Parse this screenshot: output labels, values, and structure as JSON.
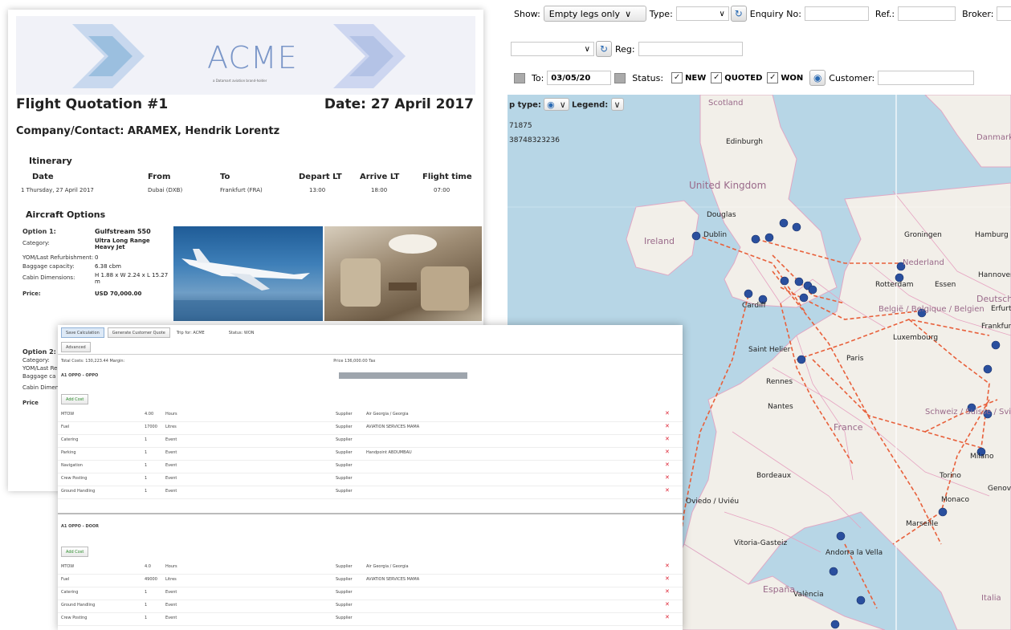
{
  "map_toolbar": {
    "show_label": "Show:",
    "show_value": "Empty legs only",
    "type_label": "Type:",
    "enquiry_label": "Enquiry No:",
    "ref_label": "Ref.:",
    "broker_label": "Broker:",
    "reg_label": "Reg:",
    "to_label": "To:",
    "to_value": "03/05/20",
    "status_label": "Status:",
    "statuses": [
      "NEW",
      "QUOTED",
      "WON"
    ],
    "customer_label": "Customer:",
    "map_type_label": "p type:",
    "legend_label": "Legend:",
    "coord_1": "71875",
    "coord_2": "38748323236"
  },
  "map": {
    "labels": [
      {
        "text": "Edinburgh",
        "kind": "city"
      },
      {
        "text": "United Kingdom",
        "kind": "country"
      },
      {
        "text": "Douglas",
        "kind": "city"
      },
      {
        "text": "Ireland",
        "kind": "country"
      },
      {
        "text": "Dublin",
        "kind": "city"
      },
      {
        "text": "Cardiff",
        "kind": "city"
      },
      {
        "text": "Groningen",
        "kind": "city"
      },
      {
        "text": "Hamburg",
        "kind": "city"
      },
      {
        "text": "Nederland",
        "kind": "country"
      },
      {
        "text": "Rotterdam",
        "kind": "city"
      },
      {
        "text": "Essen",
        "kind": "city"
      },
      {
        "text": "Hannover",
        "kind": "city"
      },
      {
        "text": "Deutschland",
        "kind": "country"
      },
      {
        "text": "Erfurt",
        "kind": "city"
      },
      {
        "text": "België / Belgique / Belgien",
        "kind": "country"
      },
      {
        "text": "Luxembourg",
        "kind": "city"
      },
      {
        "text": "Frankfurt am Main",
        "kind": "city"
      },
      {
        "text": "Saint Helier",
        "kind": "city"
      },
      {
        "text": "Paris",
        "kind": "city"
      },
      {
        "text": "Rennes",
        "kind": "city"
      },
      {
        "text": "Nantes",
        "kind": "city"
      },
      {
        "text": "France",
        "kind": "country"
      },
      {
        "text": "Schweiz / Suisse / Svizzera / Svizra",
        "kind": "country"
      },
      {
        "text": "Milano",
        "kind": "city"
      },
      {
        "text": "Bordeaux",
        "kind": "city"
      },
      {
        "text": "Torino",
        "kind": "city"
      },
      {
        "text": "Genova",
        "kind": "city"
      },
      {
        "text": "Monaco",
        "kind": "city"
      },
      {
        "text": "Marseille",
        "kind": "city"
      },
      {
        "text": "Oviedo / Uviéu",
        "kind": "city"
      },
      {
        "text": "Vitoria-Gasteiz",
        "kind": "city"
      },
      {
        "text": "Andorra la Vella",
        "kind": "city"
      },
      {
        "text": "España",
        "kind": "country"
      },
      {
        "text": "València",
        "kind": "city"
      },
      {
        "text": "Italia",
        "kind": "country"
      },
      {
        "text": "Danmark",
        "kind": "country"
      },
      {
        "text": "Scotland",
        "kind": "country"
      }
    ]
  },
  "quote": {
    "logo": "ACME",
    "logo_sub": "a Datamart aviation brand-holder",
    "title": "Flight Quotation #1",
    "date": "Date: 27 April 2017",
    "company": "Company/Contact: ARAMEX, Hendrik Lorentz",
    "itinerary_title": "Itinerary",
    "headers": [
      "Date",
      "From",
      "To",
      "Depart LT",
      "Arrive LT",
      "Flight time"
    ],
    "row": [
      "1 Thursday, 27 April 2017",
      "Dubai (DXB)",
      "Frankfurt (FRA)",
      "13:00",
      "18:00",
      "07:00"
    ],
    "options_title": "Aircraft Options",
    "option1": [
      {
        "label": "Option 1:",
        "value": "Gulfstream 550"
      },
      {
        "label": "Category:",
        "value": "Ultra Long Range Heavy Jet"
      },
      {
        "label": "YOM/Last Refurbishment:",
        "value": "0"
      },
      {
        "label": "Baggage capacity:",
        "value": "6.38 cbm"
      },
      {
        "label": "Cabin Dimensions:",
        "value": "H 1.88 x W 2.24 x L 15.27 m"
      },
      {
        "label": "Price:",
        "value": "USD 70,000.00"
      }
    ],
    "option2": [
      {
        "label": "Option 2:"
      },
      {
        "label": "Category:"
      },
      {
        "label": "YOM/Last Re"
      },
      {
        "label": "Baggage ca"
      },
      {
        "label": "Cabin Dimen"
      },
      {
        "label": "Price"
      }
    ]
  },
  "calc": {
    "tabs": [
      "Save Calculation",
      "Generate Customer Quote",
      "Trip for: ACME",
      "Status: WON"
    ],
    "subtab": "Advanced",
    "totals": "Total Costs: 130,223.44 Margin:",
    "price_label": "Price 136,000.00 Tax",
    "leg1": "A1 OPPO - OPPO",
    "leg2": "A1 OPPO - DOOR",
    "costs_block1": [
      {
        "name": "MTOW",
        "qty": "4.00",
        "unit": "Hours",
        "supplier": "Supplier",
        "partner": "Air Georgia / Georgia"
      },
      {
        "name": "Fuel",
        "qty": "17000",
        "unit": "Litres",
        "supplier": "Supplier",
        "partner": "AVIATION SERVICES MAMA"
      },
      {
        "name": "Catering",
        "qty": "1",
        "unit": "Event",
        "supplier": "Supplier",
        "partner": ""
      },
      {
        "name": "Parking",
        "qty": "1",
        "unit": "Event",
        "supplier": "Supplier",
        "partner": "Handpoint ABDUMBAU"
      },
      {
        "name": "Navigation",
        "qty": "1",
        "unit": "Event",
        "supplier": "Supplier",
        "partner": ""
      },
      {
        "name": "Crew Posting",
        "qty": "1",
        "unit": "Event",
        "supplier": "Supplier",
        "partner": ""
      },
      {
        "name": "Ground Handling",
        "qty": "1",
        "unit": "Event",
        "supplier": "Supplier",
        "partner": ""
      }
    ],
    "costs_block2": [
      {
        "name": "MTOW",
        "qty": "4.0",
        "unit": "Hours",
        "supplier": "Supplier",
        "partner": "Air Georgia / Georgia"
      },
      {
        "name": "Fuel",
        "qty": "49000",
        "unit": "Litres",
        "supplier": "Supplier",
        "partner": "AVIATION SERVICES MAMA"
      },
      {
        "name": "Catering",
        "qty": "1",
        "unit": "Event",
        "supplier": "Supplier",
        "partner": ""
      },
      {
        "name": "Ground Handling",
        "qty": "1",
        "unit": "Event",
        "supplier": "Supplier",
        "partner": ""
      },
      {
        "name": "Crew Posting",
        "qty": "1",
        "unit": "Event",
        "supplier": "Supplier",
        "partner": ""
      }
    ],
    "add_cost": "Add Cost"
  },
  "colors": {
    "route": "#e8603b",
    "marker": "#2a4f9e",
    "sea": "#b7d6e6",
    "land": "#f2efe9"
  }
}
